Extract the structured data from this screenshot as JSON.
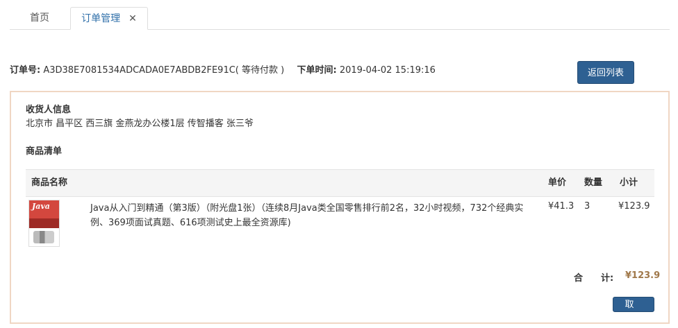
{
  "tabs": [
    {
      "label": "首页"
    },
    {
      "label": "订单管理",
      "close": "✕"
    }
  ],
  "order": {
    "number_label": "订单号:",
    "number": "A3D38E7081534ADCADA0E7ABDB2FE91C( 等待付款 )",
    "time_label": "下单时间:",
    "time": "2019-04-02 15:19:16"
  },
  "back_button": "返回列表",
  "receiver": {
    "title": "收货人信息",
    "address": "北京市 昌平区 西三旗 金燕龙办公楼1层 传智播客 张三爷"
  },
  "goods": {
    "title": "商品清单",
    "headers": {
      "name": "商品名称",
      "price": "单价",
      "qty": "数量",
      "subtotal": "小计"
    },
    "items": [
      {
        "name": "Java从入门到精通（第3版）（附光盘1张）（连续8月Java类全国零售排行前2名，32小时视频，732个经典实例、369项面试真题、616项测试史上最全资源库)",
        "price": "¥41.3",
        "qty": "3",
        "subtotal": "¥123.9",
        "thumb_text": "Java"
      }
    ]
  },
  "total": {
    "label": "合　　计:",
    "value": "¥123.9"
  },
  "cancel_button": "取消"
}
